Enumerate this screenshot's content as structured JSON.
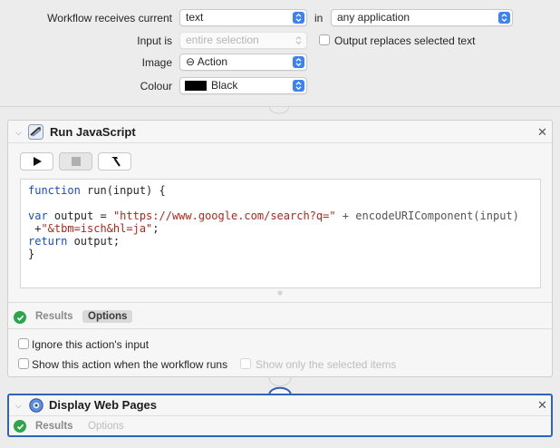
{
  "workflow": {
    "receives_label": "Workflow receives current",
    "receives_value": "text",
    "in_label": "in",
    "in_value": "any application",
    "input_is_label": "Input is",
    "input_is_value": "entire selection",
    "output_replaces_label": "Output replaces selected text",
    "image_label": "Image",
    "image_value": "⊖ Action",
    "colour_label": "Colour",
    "colour_value": "Black",
    "colour_swatch": "#000000"
  },
  "run_js": {
    "title": "Run JavaScript",
    "code": {
      "line1_kw": "function",
      "line1_rest": " run(input) {",
      "line3_kw": "var",
      "line3_mid": " output = ",
      "line3_str": "\"https://www.google.com/search?q=\"",
      "line3_tail": " + encodeURIComponent(input)",
      "line4_plus": " +",
      "line4_str": "\"&tbm=isch&hl=ja\"",
      "line4_end": ";",
      "line5_kw": "return",
      "line5_rest": " output;",
      "line6": "}"
    },
    "tabs": {
      "results": "Results",
      "options": "Options"
    },
    "opt_ignore": "Ignore this action's input",
    "opt_show_when_runs": "Show this action when the workflow runs",
    "opt_show_selected": "Show only the selected items"
  },
  "display_web": {
    "title": "Display Web Pages",
    "tabs": {
      "results": "Results",
      "options": "Options"
    }
  },
  "colors": {
    "accent": "#3b82f7",
    "selected_border": "#2e63b8",
    "ok_green": "#2ca54b"
  }
}
